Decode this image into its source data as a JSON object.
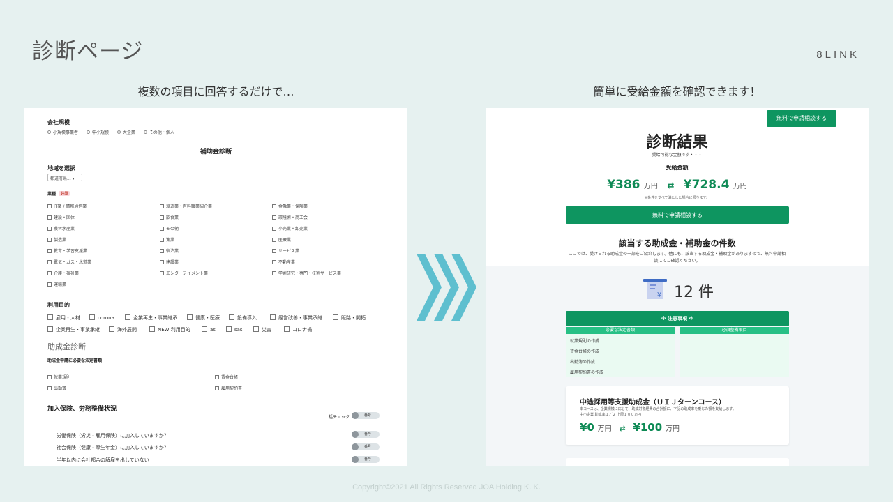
{
  "slide": {
    "title": "診断ページ",
    "brand": "8LINK",
    "caption_left": "複数の項目に回答するだけで…",
    "caption_right": "簡単に受給金額を確認できます！",
    "copyright": "Copyright©2021 All Rights Reserved JOA Holding K. K.",
    "accent": "#0e9560",
    "chevron_color": "#5ebfcf"
  },
  "form": {
    "company_size": {
      "label": "会社規模",
      "options": [
        "小規模事業者",
        "中小規模",
        "大企業",
        "その他・個人"
      ]
    },
    "heading": "補助金診断",
    "region": {
      "label": "地域を選択",
      "value": "都道府県..."
    },
    "industry": {
      "label": "業種",
      "required": "必須",
      "items": [
        "IT業 / 情報通信業",
        "派遣業・有料職業紹介業",
        "金融業・保険業",
        "建設・固体",
        "飲食業",
        "環境術・商工会",
        "農林水産業",
        "その他",
        "小売業・卸売業",
        "製造業",
        "漁業",
        "医療業",
        "教育・学習支援業",
        "宿泊業",
        "サービス業",
        "電気・ガス・水道業",
        "建設業",
        "不動産業",
        "介護・福祉業",
        "エンターテイメント業",
        "学術研究・専門・技術サービス業",
        "運輸業"
      ]
    },
    "purpose": {
      "label": "利用目的",
      "row1": [
        "雇用・人材",
        "corona",
        "企業再生・事業継承",
        "健康・医療",
        "設備導入",
        "経営改善・事業承継",
        "販路・開拓"
      ],
      "row2": [
        "企業再生・事業承継",
        "海外展開",
        "NEW 利用目的",
        "as",
        "sas",
        "災害",
        "コロナ禍"
      ]
    },
    "subsidy_section": "助成金診断",
    "docs": {
      "label": "助成金申請に必要な法定書類",
      "items": [
        "就業規則",
        "賃金台帳",
        "出勤簿",
        "雇用契約書"
      ]
    },
    "insurance": {
      "label": "加入保険、労務整備状況",
      "bulk_check": "括チェック",
      "toggle_label": "番号",
      "questions": [
        "労働保険（労災・雇用保険）に加入していますか？",
        "社会保険（健康・厚生年金）に加入していますか？",
        "半年以内に会社都合の解雇を出していない"
      ]
    }
  },
  "result": {
    "top_button": "無料で申請相談する",
    "title": "診断結果",
    "subtitle": "受給可能な金額です・・・",
    "amount_label": "受給金額",
    "min": "¥386",
    "max": "¥728.4",
    "unit": "万円",
    "note": "※条件をすべて満たした場合に限ります。",
    "cta": "無料で申請相談する",
    "count_heading": "該当する助成金・補助金の件数",
    "count_desc_1": "ここでは、受けられる助成金の一部をご紹介します。他にも、該当する助成金・補助金がありますので、無料申請相",
    "count_desc_2": "談にてご確認ください。",
    "count": "12",
    "count_unit": "件",
    "notice": "※ 注意事項 ※",
    "col_left": "必要な法定書類",
    "col_right": "必須整備項目",
    "col_left_items": [
      "就業規則の作成",
      "賃金台帳の作成",
      "出勤簿の作成",
      "雇用契約書の作成"
    ],
    "grant": {
      "title": "中途採用等支援助成金（ＵＩＪターンコース）",
      "desc_1": "本コースは、企業規模に応じて、助成対象経費の合計額に、下記の助成率を乗じた額を支給します。",
      "desc_2": "中小企業 助成率１／２ 上限１００万円",
      "min": "¥0",
      "max": "¥100",
      "unit": "万円"
    }
  }
}
